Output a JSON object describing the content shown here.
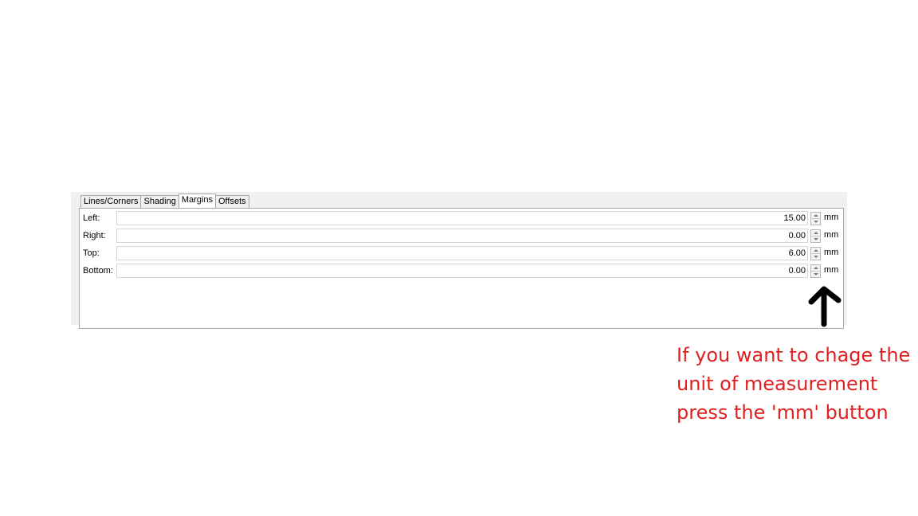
{
  "tabs": [
    {
      "label": "Lines/Corners"
    },
    {
      "label": "Shading"
    },
    {
      "label": "Margins"
    },
    {
      "label": "Offsets"
    }
  ],
  "active_tab": "Margins",
  "margins": [
    {
      "label": "Left:",
      "value": "15.00",
      "unit": "mm"
    },
    {
      "label": "Right:",
      "value": "0.00",
      "unit": "mm"
    },
    {
      "label": "Top:",
      "value": "6.00",
      "unit": "mm"
    },
    {
      "label": "Bottom:",
      "value": "0.00",
      "unit": "mm"
    }
  ],
  "annotation": {
    "lines": [
      "If you want to chage the",
      "unit of measurement",
      "press the 'mm' button"
    ],
    "color": "#e02020"
  }
}
